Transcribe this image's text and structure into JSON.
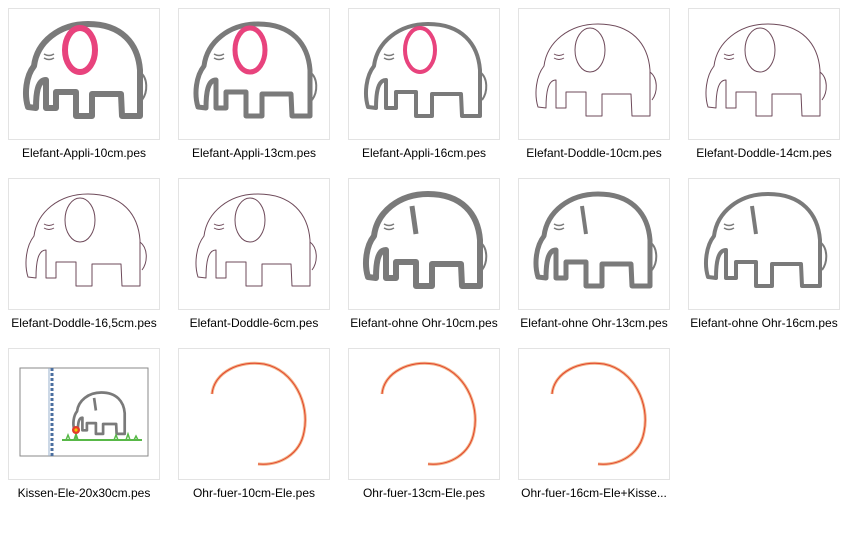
{
  "files": [
    {
      "name": "Elefant-Appli-10cm.pes",
      "icon": "elephant-applique-thumbnail-icon"
    },
    {
      "name": "Elefant-Appli-13cm.pes",
      "icon": "elephant-applique-thumbnail-icon"
    },
    {
      "name": "Elefant-Appli-16cm.pes",
      "icon": "elephant-applique-thumbnail-icon"
    },
    {
      "name": "Elefant-Doddle-10cm.pes",
      "icon": "elephant-doodle-thumbnail-icon"
    },
    {
      "name": "Elefant-Doddle-14cm.pes",
      "icon": "elephant-doodle-thumbnail-icon"
    },
    {
      "name": "Elefant-Doddle-16,5cm.pes",
      "icon": "elephant-doodle-thumbnail-icon"
    },
    {
      "name": "Elefant-Doddle-6cm.pes",
      "icon": "elephant-doodle-thumbnail-icon"
    },
    {
      "name": "Elefant-ohne Ohr-10cm.pes",
      "icon": "elephant-no-ear-thumbnail-icon"
    },
    {
      "name": "Elefant-ohne Ohr-13cm.pes",
      "icon": "elephant-no-ear-thumbnail-icon"
    },
    {
      "name": "Elefant-ohne Ohr-16cm.pes",
      "icon": "elephant-no-ear-thumbnail-icon"
    },
    {
      "name": "Kissen-Ele-20x30cm.pes",
      "icon": "pillow-elephant-thumbnail-icon"
    },
    {
      "name": "Ohr-fuer-10cm-Ele.pes",
      "icon": "ear-outline-thumbnail-icon"
    },
    {
      "name": "Ohr-fuer-13cm-Ele.pes",
      "icon": "ear-outline-thumbnail-icon"
    },
    {
      "name": "Ohr-fuer-16cm-Ele+Kisse...",
      "icon": "ear-outline-thumbnail-icon"
    }
  ],
  "colors": {
    "stitch_gray": "#7a7a7a",
    "applique_pink": "#e8437d",
    "doodle_line": "#6e4a5a",
    "ear_red": "#e2452b",
    "ear_peach": "#f2b48a",
    "grass_green": "#58b848",
    "flower_red": "#e23b2b",
    "pillow_stripe": "#4b6fa0"
  }
}
